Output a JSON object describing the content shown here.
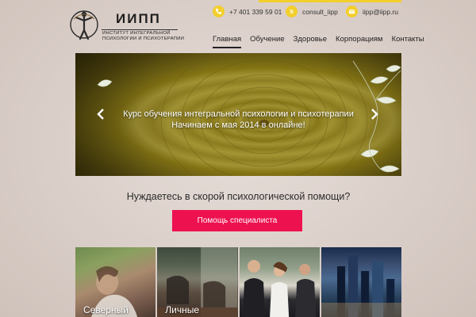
{
  "logo": {
    "title": "ИИПП",
    "subtitle_line1": "ИНСТИТУТ ИНТЕГРАЛЬНОЙ",
    "subtitle_line2": "ПСИХОЛОГИИ И ПСИХОТЕРАПИИ"
  },
  "contacts": {
    "phone": "+7 401 339 59 01",
    "skype": "consult_iipp",
    "email": "iipp@iipp.ru"
  },
  "nav": {
    "items": [
      "Главная",
      "Обучение",
      "Здоровье",
      "Корпорациям",
      "Контакты"
    ],
    "active": "Главная"
  },
  "hero": {
    "line1": "Курс обучения интегральной психологии и психотерапии",
    "line2": "Начинаем с мая 2014 в онлайне!"
  },
  "help": {
    "question": "Нуждаетесь в скорой психологической помощи?",
    "button_label": "Помощь специалиста"
  },
  "tiles": [
    {
      "label": "Северный"
    },
    {
      "label": "Личные"
    },
    {
      "label": ""
    },
    {
      "label": ""
    }
  ],
  "colors": {
    "accent_yellow": "#f2cf2b",
    "button_red": "#ee1150"
  }
}
